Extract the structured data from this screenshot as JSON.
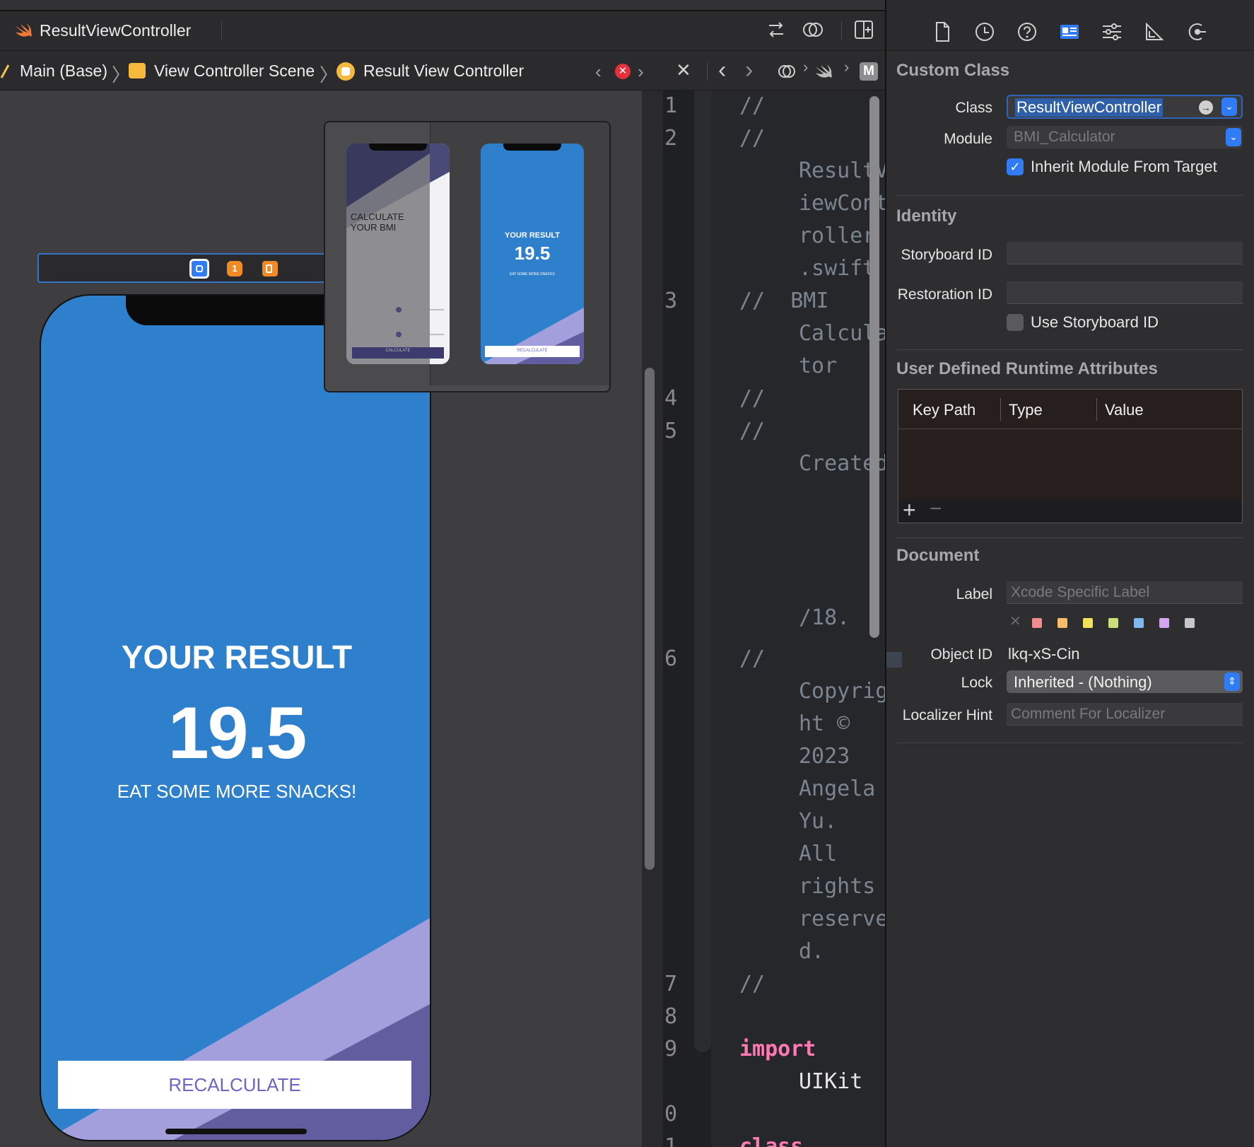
{
  "tab": {
    "title": "ResultViewController"
  },
  "breadcrumb": {
    "items": [
      "Main (Base)",
      "View Controller Scene",
      "Result View Controller"
    ],
    "right_badge": "M"
  },
  "canvas": {
    "result_title": "YOUR RESULT",
    "bmi_value": "19.5",
    "advice": "EAT SOME MORE SNACKS!",
    "recalculate_label": "RECALCULATE",
    "overview": {
      "mini1_text": "CALCULATE\nYOUR BMI",
      "mini1_button": "CALCULATE",
      "mini2_title": "YOUR RESULT",
      "mini2_value": "19.5",
      "mini2_advice": "EAT SOME MORE SNACKS",
      "mini2_button": "RECALCULATE"
    }
  },
  "editor": {
    "line_numbers": [
      "1",
      "2",
      "3",
      "4",
      "5",
      "6",
      "7",
      "8",
      "9",
      "0",
      "1"
    ],
    "lines": [
      "//",
      "//",
      "ResultV",
      "iewCont",
      "roller",
      ".swift",
      "//  BMI",
      "Calcula",
      "tor",
      "//",
      "//",
      "Created",
      "/18.",
      "//",
      "Copyrig",
      "ht ©",
      "2023",
      "Angela",
      "Yu.",
      "All",
      "rights",
      "reserve",
      "d.",
      "//",
      "import",
      "UIKit",
      "class"
    ]
  },
  "inspector": {
    "custom_class": {
      "section": "Custom Class",
      "class_label": "Class",
      "class_value": "ResultViewController",
      "module_label": "Module",
      "module_placeholder": "BMI_Calculator",
      "inherit_label": "Inherit Module From Target"
    },
    "identity": {
      "section": "Identity",
      "storyboard_id_label": "Storyboard ID",
      "restoration_id_label": "Restoration ID",
      "use_storyboard_id_label": "Use Storyboard ID"
    },
    "udra": {
      "section": "User Defined Runtime Attributes",
      "columns": [
        "Key Path",
        "Type",
        "Value"
      ]
    },
    "document": {
      "section": "Document",
      "label_label": "Label",
      "label_placeholder": "Xcode Specific Label",
      "object_id_label": "Object ID",
      "object_id_value": "lkq-xS-Cin",
      "lock_label": "Lock",
      "lock_value": "Inherited - (Nothing)",
      "localizer_hint_label": "Localizer Hint",
      "localizer_hint_placeholder": "Comment For Localizer",
      "swatch_colors": [
        "#f28b8b",
        "#f7bd6a",
        "#f2e05c",
        "#c9e07a",
        "#7fb9ef",
        "#d3a6ef",
        "#c7c7c9"
      ]
    }
  },
  "colors": {
    "accent": "#2f7cf6",
    "phone_blue": "#2f80cc",
    "triangle_light": "#a29fdc",
    "triangle_dark": "#625d9f",
    "keyword": "#ff7ab2"
  }
}
